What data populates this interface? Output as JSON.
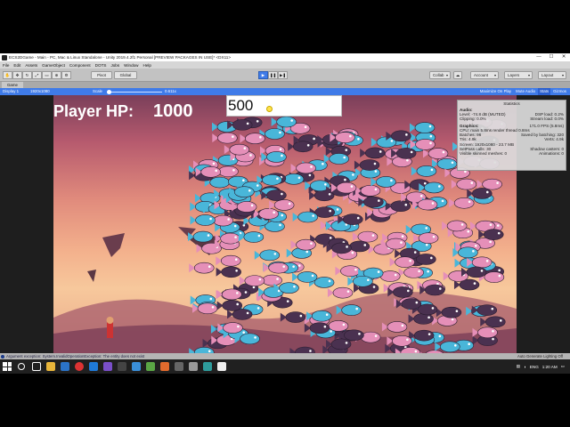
{
  "window": {
    "title": "ECS2DGame - Main - PC, Mac & Linux Standalone - Unity 2019.4.2f1 Personal [PREVIEW PACKAGES IN USE]* <DX11>",
    "controls": [
      "—",
      "☐",
      "✕"
    ]
  },
  "menu": [
    "File",
    "Edit",
    "Assets",
    "GameObject",
    "Component",
    "DOTS",
    "Jobs",
    "Window",
    "Help"
  ],
  "toolbar": {
    "pivot": "Pivot",
    "global": "Global",
    "collab": "Collab",
    "account": "Account",
    "layers": "Layers",
    "layout": "Layout",
    "play_icon": "▶",
    "pause_icon": "❚❚",
    "step_icon": "▶❚"
  },
  "game_tab": {
    "label": "Game"
  },
  "game_bar": {
    "display": "Display 1",
    "resolution": "1920x1080",
    "scale_label": "Scale",
    "scale_value": "0.611x",
    "maximize": "Maximize On Play",
    "mute": "Mute Audio",
    "stats": "Stats",
    "gizmos": "Gizmos"
  },
  "game": {
    "hp_label": "Player HP:",
    "hp_value": "1000",
    "input_value": "500"
  },
  "stats": {
    "header": "Statistics",
    "audio_title": "Audio:",
    "level": "Level: -74.8 dB (MUTED)",
    "dsp": "DSP load: 0.2%",
    "clipping": "Clipping: 0.0%",
    "stream": "Stream load: 0.0%",
    "graphics_title": "Graphics:",
    "fps": "171.0 FPS (5.8ms)",
    "cpu": "CPU: main 5.8ms  render thread 0.8ms",
    "batches": "Batches: 96",
    "saved": "Saved by batching: 320",
    "tris": "Tris: 4.9k",
    "verts": "Verts: 4.9k",
    "screen": "Screen: 1920x1080 - 23.7 MB",
    "setpass": "SetPass calls: 30",
    "shadow": "Shadow casters: 0",
    "skinned": "Visible skinned meshes: 0",
    "animations": "Animations: 0"
  },
  "status": {
    "message": "Argument exception: System.InvalidOperationException: The entity does not exist",
    "right": "Auto Generate Lighting Off"
  },
  "taskbar": {
    "lang": "ENG",
    "time": "1:20 AM"
  },
  "colors": {
    "accent": "#3f7be8",
    "fish_pink": "#e58fb8",
    "fish_blue": "#49b6d9",
    "fish_dark": "#4a3150"
  }
}
